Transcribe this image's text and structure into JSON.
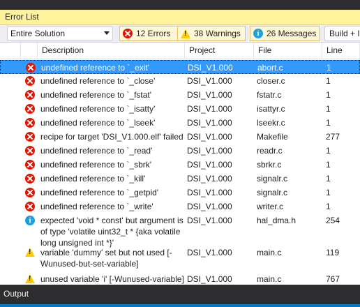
{
  "panel": {
    "title": "Error List"
  },
  "toolbar": {
    "scope": "Entire Solution",
    "errors_label": "12 Errors",
    "warnings_label": "38 Warnings",
    "messages_label": "26 Messages",
    "build_label": "Build + I"
  },
  "columns": [
    "Description",
    "Project",
    "File",
    "Line"
  ],
  "rows": [
    {
      "type": "error",
      "description": "undefined reference to `_exit'",
      "project": "DSI_V1.000",
      "file": "abort.c",
      "line": "1",
      "selected": true
    },
    {
      "type": "error",
      "description": "undefined reference to `_close'",
      "project": "DSI_V1.000",
      "file": "closer.c",
      "line": "1"
    },
    {
      "type": "error",
      "description": "undefined reference to `_fstat'",
      "project": "DSI_V1.000",
      "file": "fstatr.c",
      "line": "1"
    },
    {
      "type": "error",
      "description": "undefined reference to `_isatty'",
      "project": "DSI_V1.000",
      "file": "isattyr.c",
      "line": "1"
    },
    {
      "type": "error",
      "description": "undefined reference to `_lseek'",
      "project": "DSI_V1.000",
      "file": "lseekr.c",
      "line": "1"
    },
    {
      "type": "error",
      "description": "recipe for target 'DSI_V1.000.elf' failed",
      "project": "DSI_V1.000",
      "file": "Makefile",
      "line": "277"
    },
    {
      "type": "error",
      "description": "undefined reference to `_read'",
      "project": "DSI_V1.000",
      "file": "readr.c",
      "line": "1"
    },
    {
      "type": "error",
      "description": "undefined reference to `_sbrk'",
      "project": "DSI_V1.000",
      "file": "sbrkr.c",
      "line": "1"
    },
    {
      "type": "error",
      "description": "undefined reference to `_kill'",
      "project": "DSI_V1.000",
      "file": "signalr.c",
      "line": "1"
    },
    {
      "type": "error",
      "description": "undefined reference to `_getpid'",
      "project": "DSI_V1.000",
      "file": "signalr.c",
      "line": "1"
    },
    {
      "type": "error",
      "description": "undefined reference to `_write'",
      "project": "DSI_V1.000",
      "file": "writer.c",
      "line": "1"
    },
    {
      "type": "info",
      "description": "expected 'void * const' but argument is of type 'volatile uint32_t * {aka volatile long unsigned int *}'",
      "project": "DSI_V1.000",
      "file": "hal_dma.h",
      "line": "254"
    },
    {
      "type": "warning",
      "description": "variable 'dummy' set but not used [-Wunused-but-set-variable]",
      "project": "DSI_V1.000",
      "file": "main.c",
      "line": "119"
    },
    {
      "type": "warning",
      "description": "unused variable 'i' [-Wunused-variable]",
      "project": "DSI_V1.000",
      "file": "main.c",
      "line": "767"
    }
  ],
  "output": {
    "title": "Output"
  }
}
